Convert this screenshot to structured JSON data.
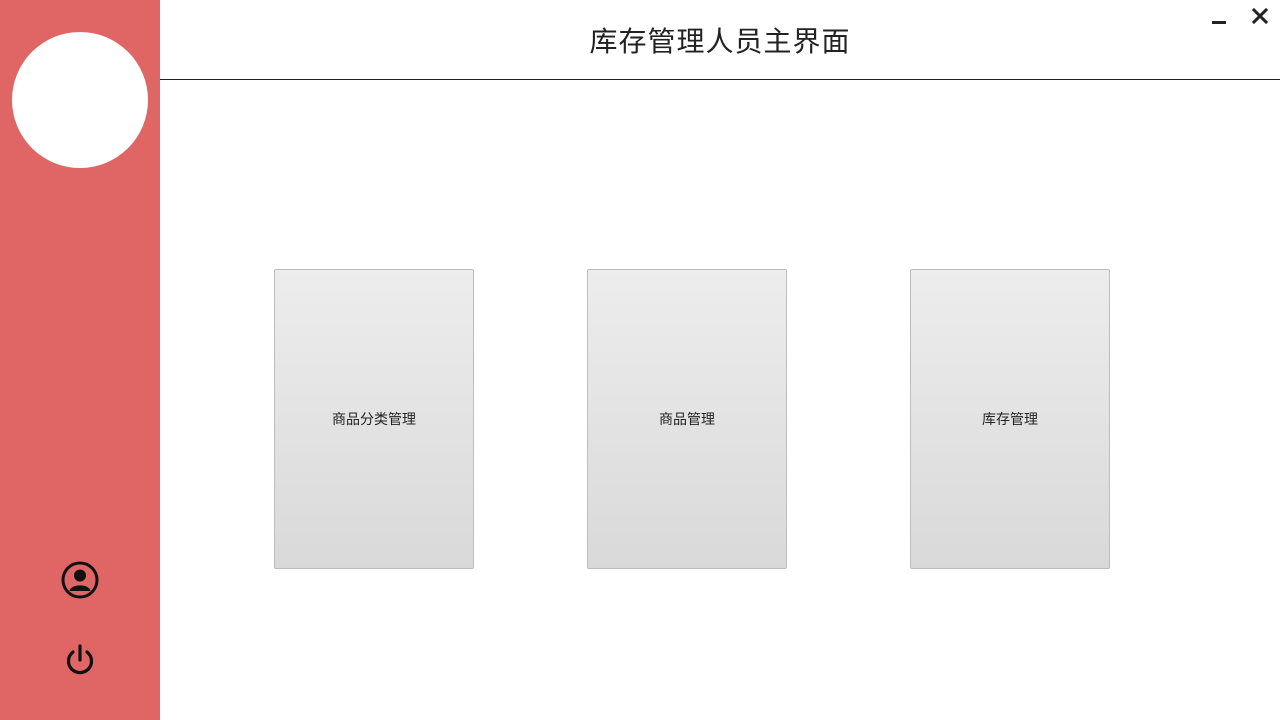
{
  "header": {
    "title": "库存管理人员主界面"
  },
  "window_controls": {
    "minimize_icon": "minimize-icon",
    "close_icon": "close-icon"
  },
  "sidebar": {
    "background_color": "#e06666",
    "avatar_color": "#ffffff",
    "profile_icon": "user-circle-icon",
    "power_icon": "power-icon"
  },
  "main": {
    "cards": [
      {
        "label": "商品分类管理"
      },
      {
        "label": "商品管理"
      },
      {
        "label": "库存管理"
      }
    ]
  }
}
